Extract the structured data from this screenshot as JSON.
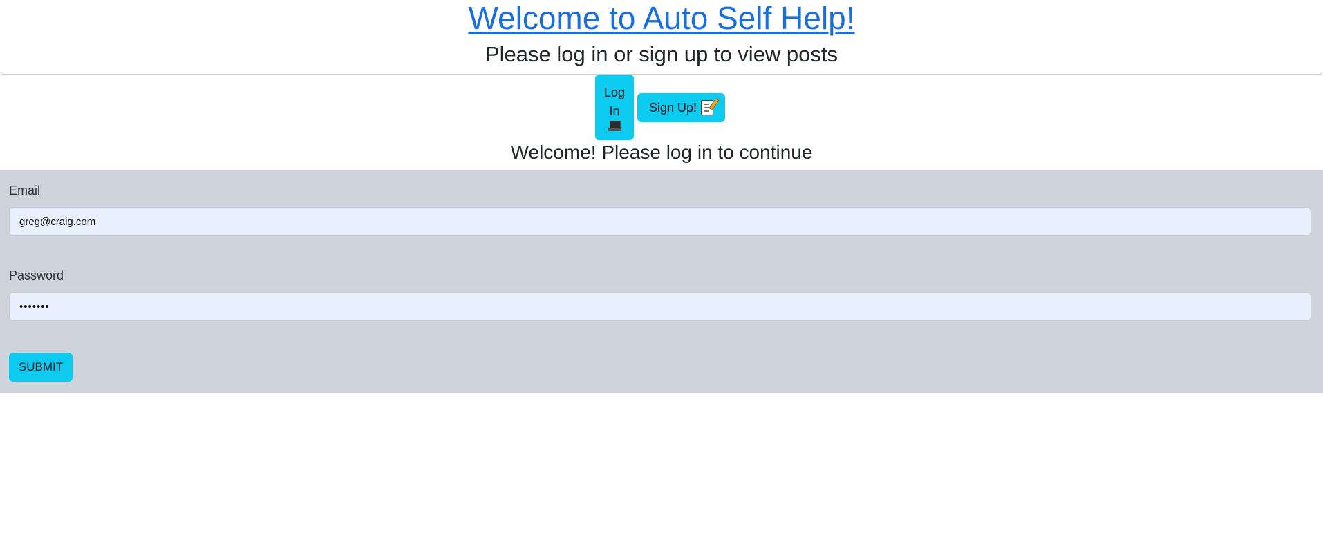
{
  "header": {
    "title": "Welcome to Auto Self Help!",
    "subtitle": "Please log in or sign up to view posts"
  },
  "nav": {
    "login_label_line1": "Log",
    "login_label_line2": "In",
    "login_icon": "laptop-icon",
    "signup_label": "Sign Up!",
    "signup_icon": "memo-icon",
    "accent_color": "#0dcaf0"
  },
  "main": {
    "welcome_text": "Welcome! Please log in to continue"
  },
  "form": {
    "email_label": "Email",
    "email_value": "greg@craig.com",
    "password_label": "Password",
    "password_value": "•••••••",
    "submit_label": "SUBMIT",
    "panel_color": "#cfd4dc"
  }
}
